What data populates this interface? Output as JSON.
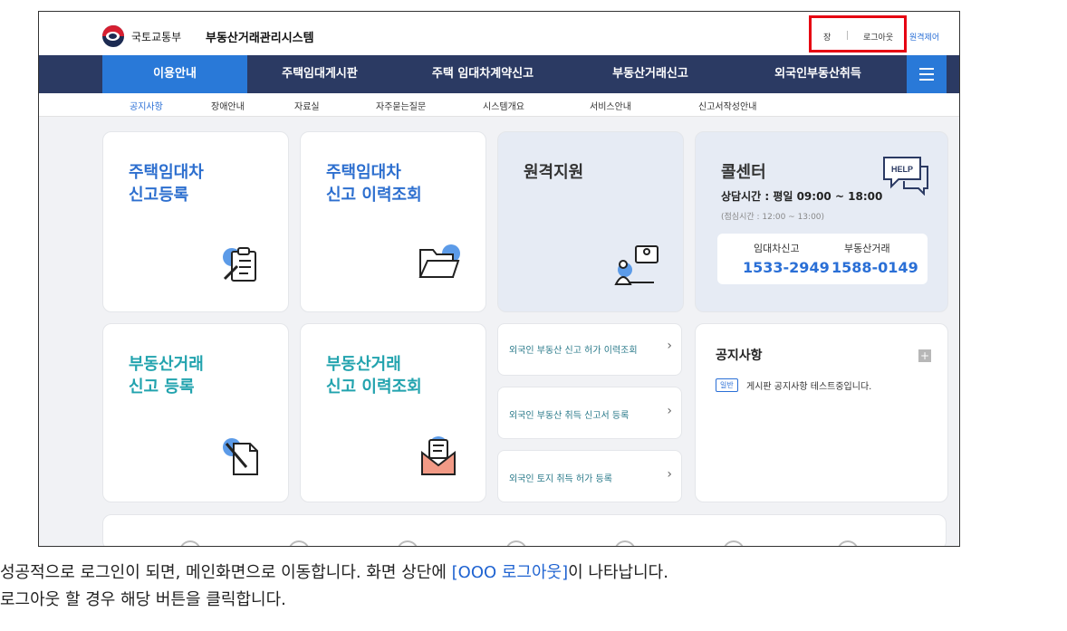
{
  "header": {
    "ministry": "국토교통부",
    "system_name": "부동산거래관리시스템",
    "user_name": "장",
    "logout": "로그아웃",
    "remote": "원격제어"
  },
  "main_nav": [
    "이용안내",
    "주택임대게시판",
    "주택 임대차계약신고",
    "부동산거래신고",
    "외국인부동산취득"
  ],
  "sub_nav": [
    "공지사항",
    "장애안내",
    "자료실",
    "자주묻는질문",
    "시스템개요",
    "서비스안내",
    "신고서작성안내"
  ],
  "cards": {
    "lease_register": "주택임대차\n신고등록",
    "lease_history": "주택임대차\n신고 이력조회",
    "remote_support": "원격지원",
    "trade_register": "부동산거래\n신고 등록",
    "trade_history": "부동산거래\n신고 이력조회"
  },
  "call_center": {
    "title": "콜센터",
    "badge": "HELP",
    "hours": "상담시간 : 평일 09:00 ~ 18:00",
    "lunch": "(점심시간 : 12:00 ~ 13:00)",
    "lease_label": "임대차신고",
    "lease_number": "1533-2949",
    "trade_label": "부동산거래",
    "trade_number": "1588-0149"
  },
  "foreign_links": [
    "외국인 부동산 신고 허가 이력조회",
    "외국인 부동산 취득 신고서 등록",
    "외국인 토지 취득 허가 등록"
  ],
  "chevron": "›",
  "notice": {
    "title": "공지사항",
    "plus": "+",
    "badge": "일반",
    "item": "게시판 공지사항 테스트중입니다."
  },
  "caption": {
    "line1_pre": "성공적으로 로그인이 되면, 메인화면으로 이동합니다. 화면 상단에 ",
    "line1_hl": "[OOO 로그아웃]",
    "line1_post": "이 나타납니다.",
    "line2": "로그아웃 할 경우 해당 버튼을 클릭합니다."
  },
  "colors": {
    "nav_bg": "#2b3a63",
    "nav_active": "#2979d8",
    "title_blue": "#2d6fcf",
    "title_teal": "#22a3ae",
    "highlight": "#e60012"
  },
  "icons": [
    "clipboard-icon",
    "folder-icon",
    "person-monitor-icon",
    "help-bubble-icon",
    "pen-document-icon",
    "mail-icon",
    "menu-icon"
  ]
}
